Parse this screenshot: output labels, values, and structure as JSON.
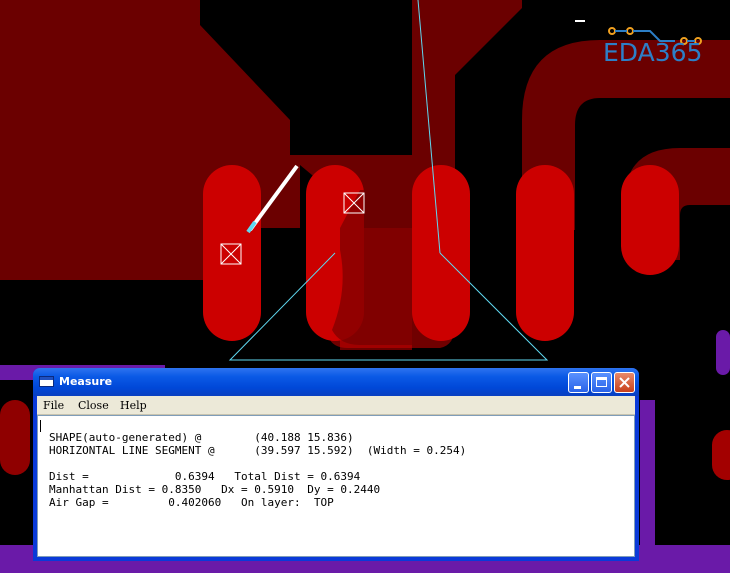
{
  "logo": {
    "text": "EDA365",
    "color": "#2c7fc7"
  },
  "board": {
    "background": "#000000",
    "copper_color": "#6b0000",
    "pad_color": "#cc0000",
    "outline_color": "#5fd8f0",
    "lower_layer_color": "#6a1aa8"
  },
  "window": {
    "title": "Measure",
    "icons": {
      "app": "window-icon",
      "minimize": "minimize-icon",
      "maximize": "maximize-icon",
      "close": "close-icon"
    },
    "menu": [
      {
        "label": "File"
      },
      {
        "label": "Close"
      },
      {
        "label": "Help"
      }
    ],
    "lines": [
      "SHAPE(auto-generated) @        (40.188 15.836)",
      "HORIZONTAL LINE SEGMENT @      (39.597 15.592)  (Width = 0.254)",
      "",
      "Dist =             0.6394   Total Dist = 0.6394",
      "Manhattan Dist = 0.8350   Dx = 0.5910  Dy = 0.2440",
      "Air Gap =         0.402060   On layer:  TOP"
    ]
  }
}
